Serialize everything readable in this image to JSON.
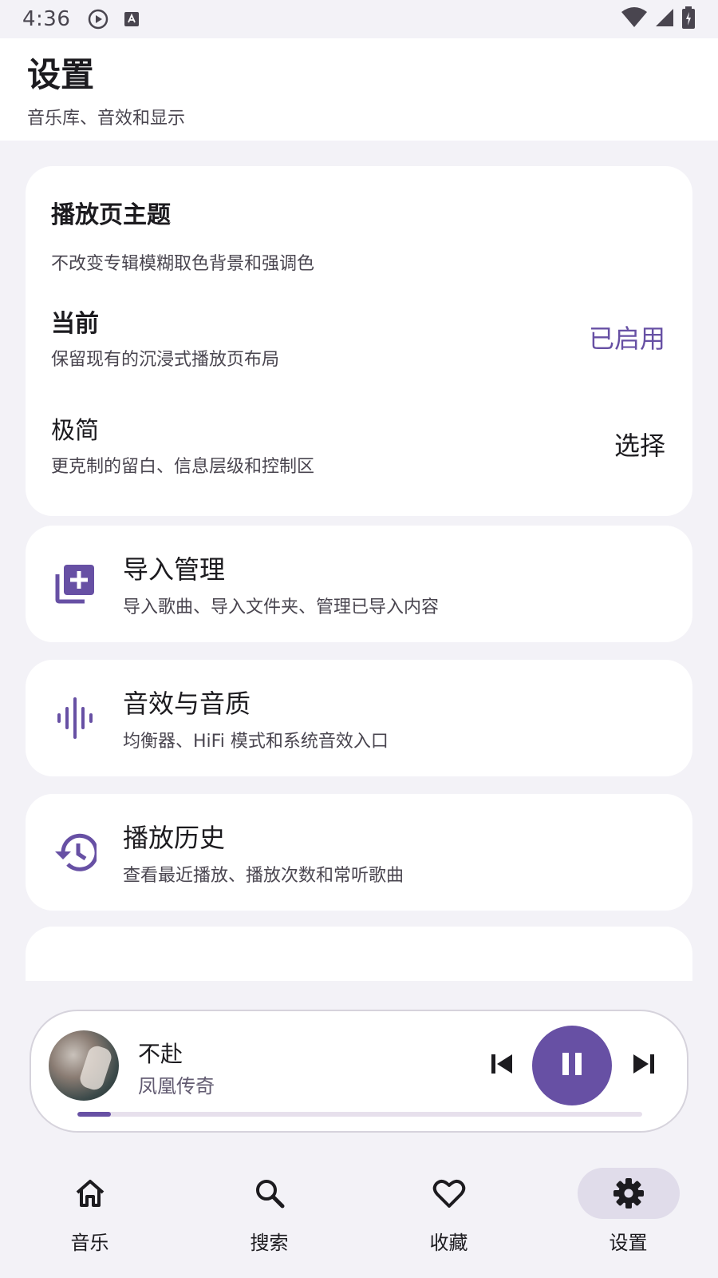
{
  "status_bar": {
    "time": "4:36"
  },
  "header": {
    "title": "设置",
    "subtitle": "音乐库、音效和显示"
  },
  "theme_card": {
    "title": "播放页主题",
    "description": "不改变专辑模糊取色背景和强调色",
    "options": [
      {
        "name": "当前",
        "description": "保留现有的沉浸式播放页布局",
        "action": "已启用"
      },
      {
        "name": "极简",
        "description": "更克制的留白、信息层级和控制区",
        "action": "选择"
      }
    ]
  },
  "menu_items": [
    {
      "icon": "library-add-icon",
      "title": "导入管理",
      "description": "导入歌曲、导入文件夹、管理已导入内容"
    },
    {
      "icon": "graphic-eq-icon",
      "title": "音效与音质",
      "description": "均衡器、HiFi 模式和系统音效入口"
    },
    {
      "icon": "history-icon",
      "title": "播放历史",
      "description": "查看最近播放、播放次数和常听歌曲"
    }
  ],
  "mini_player": {
    "song": "不赴",
    "artist": "凤凰传奇",
    "progress": 0.06
  },
  "bottom_nav": [
    {
      "label": "音乐",
      "icon": "home-icon",
      "active": false
    },
    {
      "label": "搜索",
      "icon": "search-icon",
      "active": false
    },
    {
      "label": "收藏",
      "icon": "heart-icon",
      "active": false
    },
    {
      "label": "设置",
      "icon": "gear-icon",
      "active": true
    }
  ],
  "colors": {
    "accent": "#6750a4",
    "background": "#f3f2f7",
    "card": "#ffffff"
  }
}
